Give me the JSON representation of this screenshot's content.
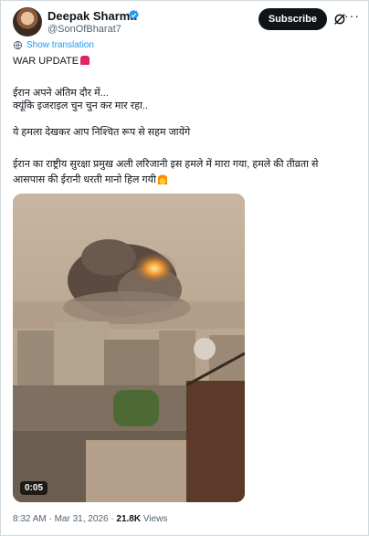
{
  "user": {
    "name": "Deepak Sharma",
    "handle": "@SonOfBharat7"
  },
  "actions": {
    "subscribe_label": "Subscribe",
    "more_label": "···"
  },
  "translation": {
    "label": "Show translation"
  },
  "post": {
    "line1": "WAR UPDATE",
    "line2": "ईरान अपने अंतिम दौर में...",
    "line3": "क्यूंकि इजराइल चुन चुन कर मार रहा..",
    "line4": "ये हमला देखकर आप निश्चित रूप से सहम जायेंगे",
    "line5": "ईरान का राष्ट्रीय सुरक्षा प्रमुख अली लरिजानी इस हमले में मारा गया, हमले की तीव्रता से",
    "line6": "आसपास की ईरानी धरती मानो हिल गयी"
  },
  "media": {
    "duration": "0:05"
  },
  "meta": {
    "time": "8:32 AM · Mar 31, 2026 · ",
    "views_count": "21.8K",
    "views_label": " Views"
  },
  "icons": {
    "verified": "verified-badge-icon",
    "grok": "grok-icon",
    "translate": "globe-icon",
    "siren": "siren-emoji",
    "fire": "fire-emoji"
  },
  "colors": {
    "link": "#1d9bf0",
    "secondary": "#536471",
    "subscribe_bg": "#0f1419"
  }
}
